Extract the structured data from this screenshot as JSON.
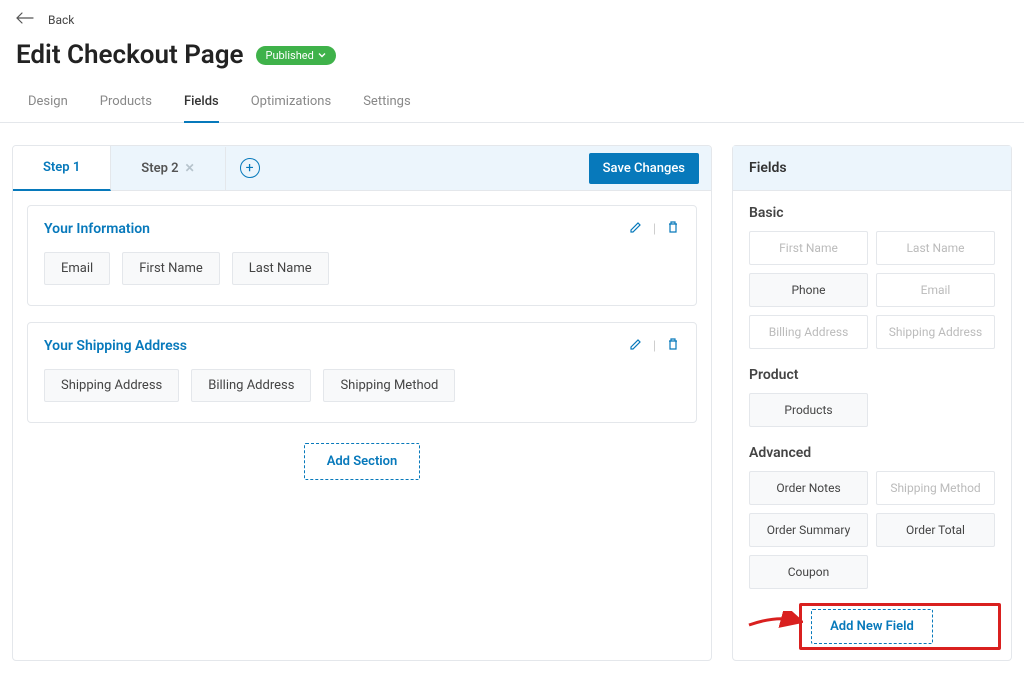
{
  "back_label": "Back",
  "page_title": "Edit Checkout Page",
  "status_badge": "Published",
  "tabs": [
    "Design",
    "Products",
    "Fields",
    "Optimizations",
    "Settings"
  ],
  "active_tab": "Fields",
  "builder": {
    "step1": "Step 1",
    "step2": "Step 2",
    "save_button": "Save Changes",
    "sections": [
      {
        "title": "Your Information",
        "fields": [
          "Email",
          "First Name",
          "Last Name"
        ]
      },
      {
        "title": "Your Shipping Address",
        "fields": [
          "Shipping Address",
          "Billing Address",
          "Shipping Method"
        ]
      }
    ],
    "add_section": "Add Section"
  },
  "panel": {
    "title": "Fields",
    "groups": {
      "basic": {
        "title": "Basic",
        "items": [
          {
            "label": "First Name",
            "disabled": true
          },
          {
            "label": "Last Name",
            "disabled": true
          },
          {
            "label": "Phone",
            "disabled": false
          },
          {
            "label": "Email",
            "disabled": true
          },
          {
            "label": "Billing Address",
            "disabled": true
          },
          {
            "label": "Shipping Address",
            "disabled": true
          }
        ]
      },
      "product": {
        "title": "Product",
        "items": [
          {
            "label": "Products",
            "disabled": false
          }
        ]
      },
      "advanced": {
        "title": "Advanced",
        "items": [
          {
            "label": "Order Notes",
            "disabled": false
          },
          {
            "label": "Shipping Method",
            "disabled": true
          },
          {
            "label": "Order Summary",
            "disabled": false
          },
          {
            "label": "Order Total",
            "disabled": false
          },
          {
            "label": "Coupon",
            "disabled": false
          }
        ]
      }
    },
    "add_new_field": "Add New Field"
  }
}
